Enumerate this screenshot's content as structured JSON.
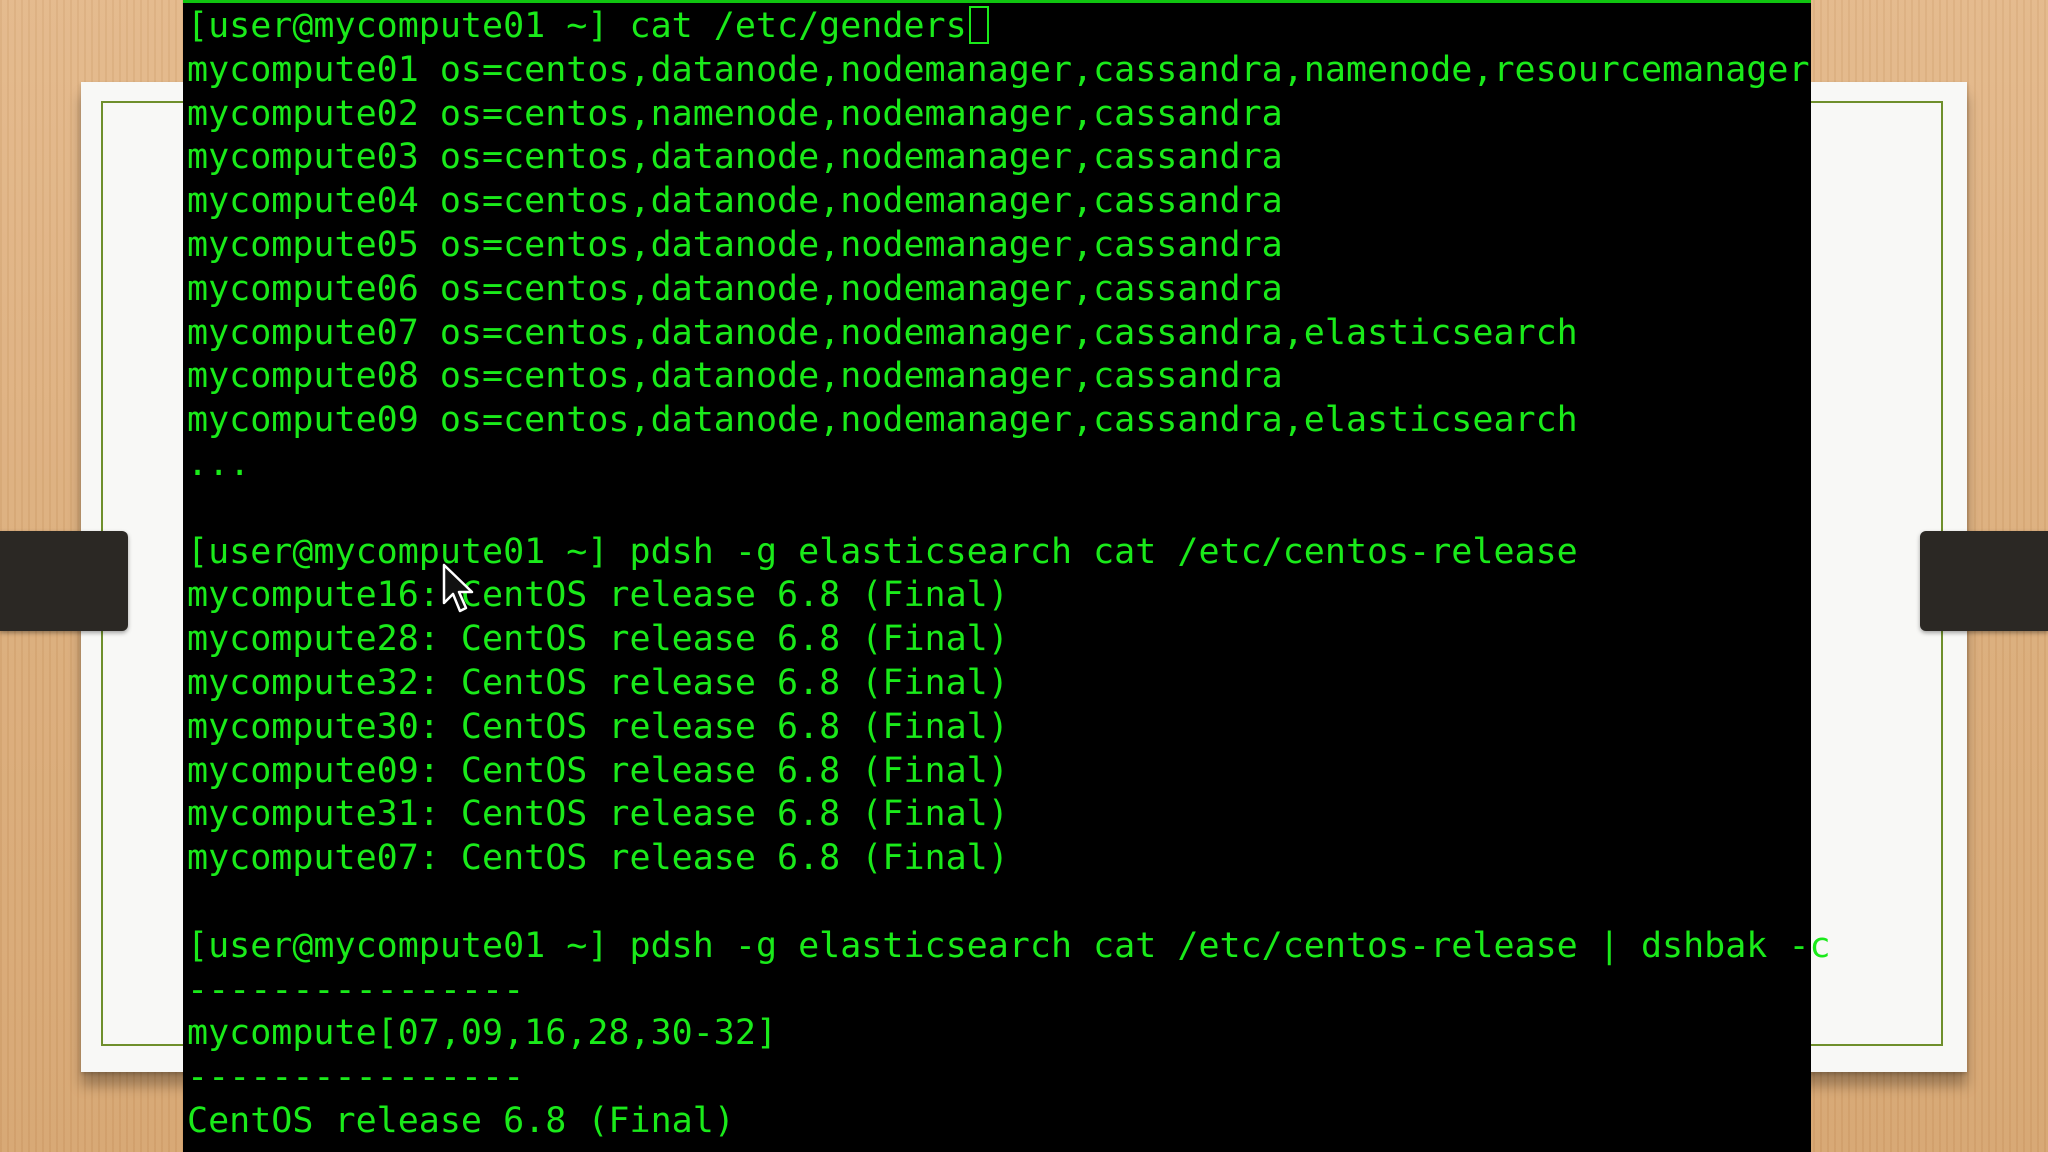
{
  "terminal": {
    "lines": [
      "[user@mycompute01 ~] cat /etc/genders",
      "mycompute01 os=centos,datanode,nodemanager,cassandra,namenode,resourcemanager",
      "mycompute02 os=centos,namenode,nodemanager,cassandra",
      "mycompute03 os=centos,datanode,nodemanager,cassandra",
      "mycompute04 os=centos,datanode,nodemanager,cassandra",
      "mycompute05 os=centos,datanode,nodemanager,cassandra",
      "mycompute06 os=centos,datanode,nodemanager,cassandra",
      "mycompute07 os=centos,datanode,nodemanager,cassandra,elasticsearch",
      "mycompute08 os=centos,datanode,nodemanager,cassandra",
      "mycompute09 os=centos,datanode,nodemanager,cassandra,elasticsearch",
      "...",
      "",
      "[user@mycompute01 ~] pdsh -g elasticsearch cat /etc/centos-release",
      "mycompute16: CentOS release 6.8 (Final)",
      "mycompute28: CentOS release 6.8 (Final)",
      "mycompute32: CentOS release 6.8 (Final)",
      "mycompute30: CentOS release 6.8 (Final)",
      "mycompute09: CentOS release 6.8 (Final)",
      "mycompute31: CentOS release 6.8 (Final)",
      "mycompute07: CentOS release 6.8 (Final)",
      "",
      "[user@mycompute01 ~] pdsh -g elasticsearch cat /etc/centos-release | dshbak -c",
      "----------------",
      "mycompute[07,09,16,28,30-32]",
      "----------------",
      "CentOS release 6.8 (Final)"
    ]
  },
  "colors": {
    "terminal_text": "#1aea1a",
    "terminal_background": "#000000",
    "slide_border": "#6f8f2c",
    "slide_background": "#f8f8f6"
  },
  "icons": {
    "text_cursor": "block-cursor-icon",
    "mouse": "mouse-pointer-icon"
  }
}
